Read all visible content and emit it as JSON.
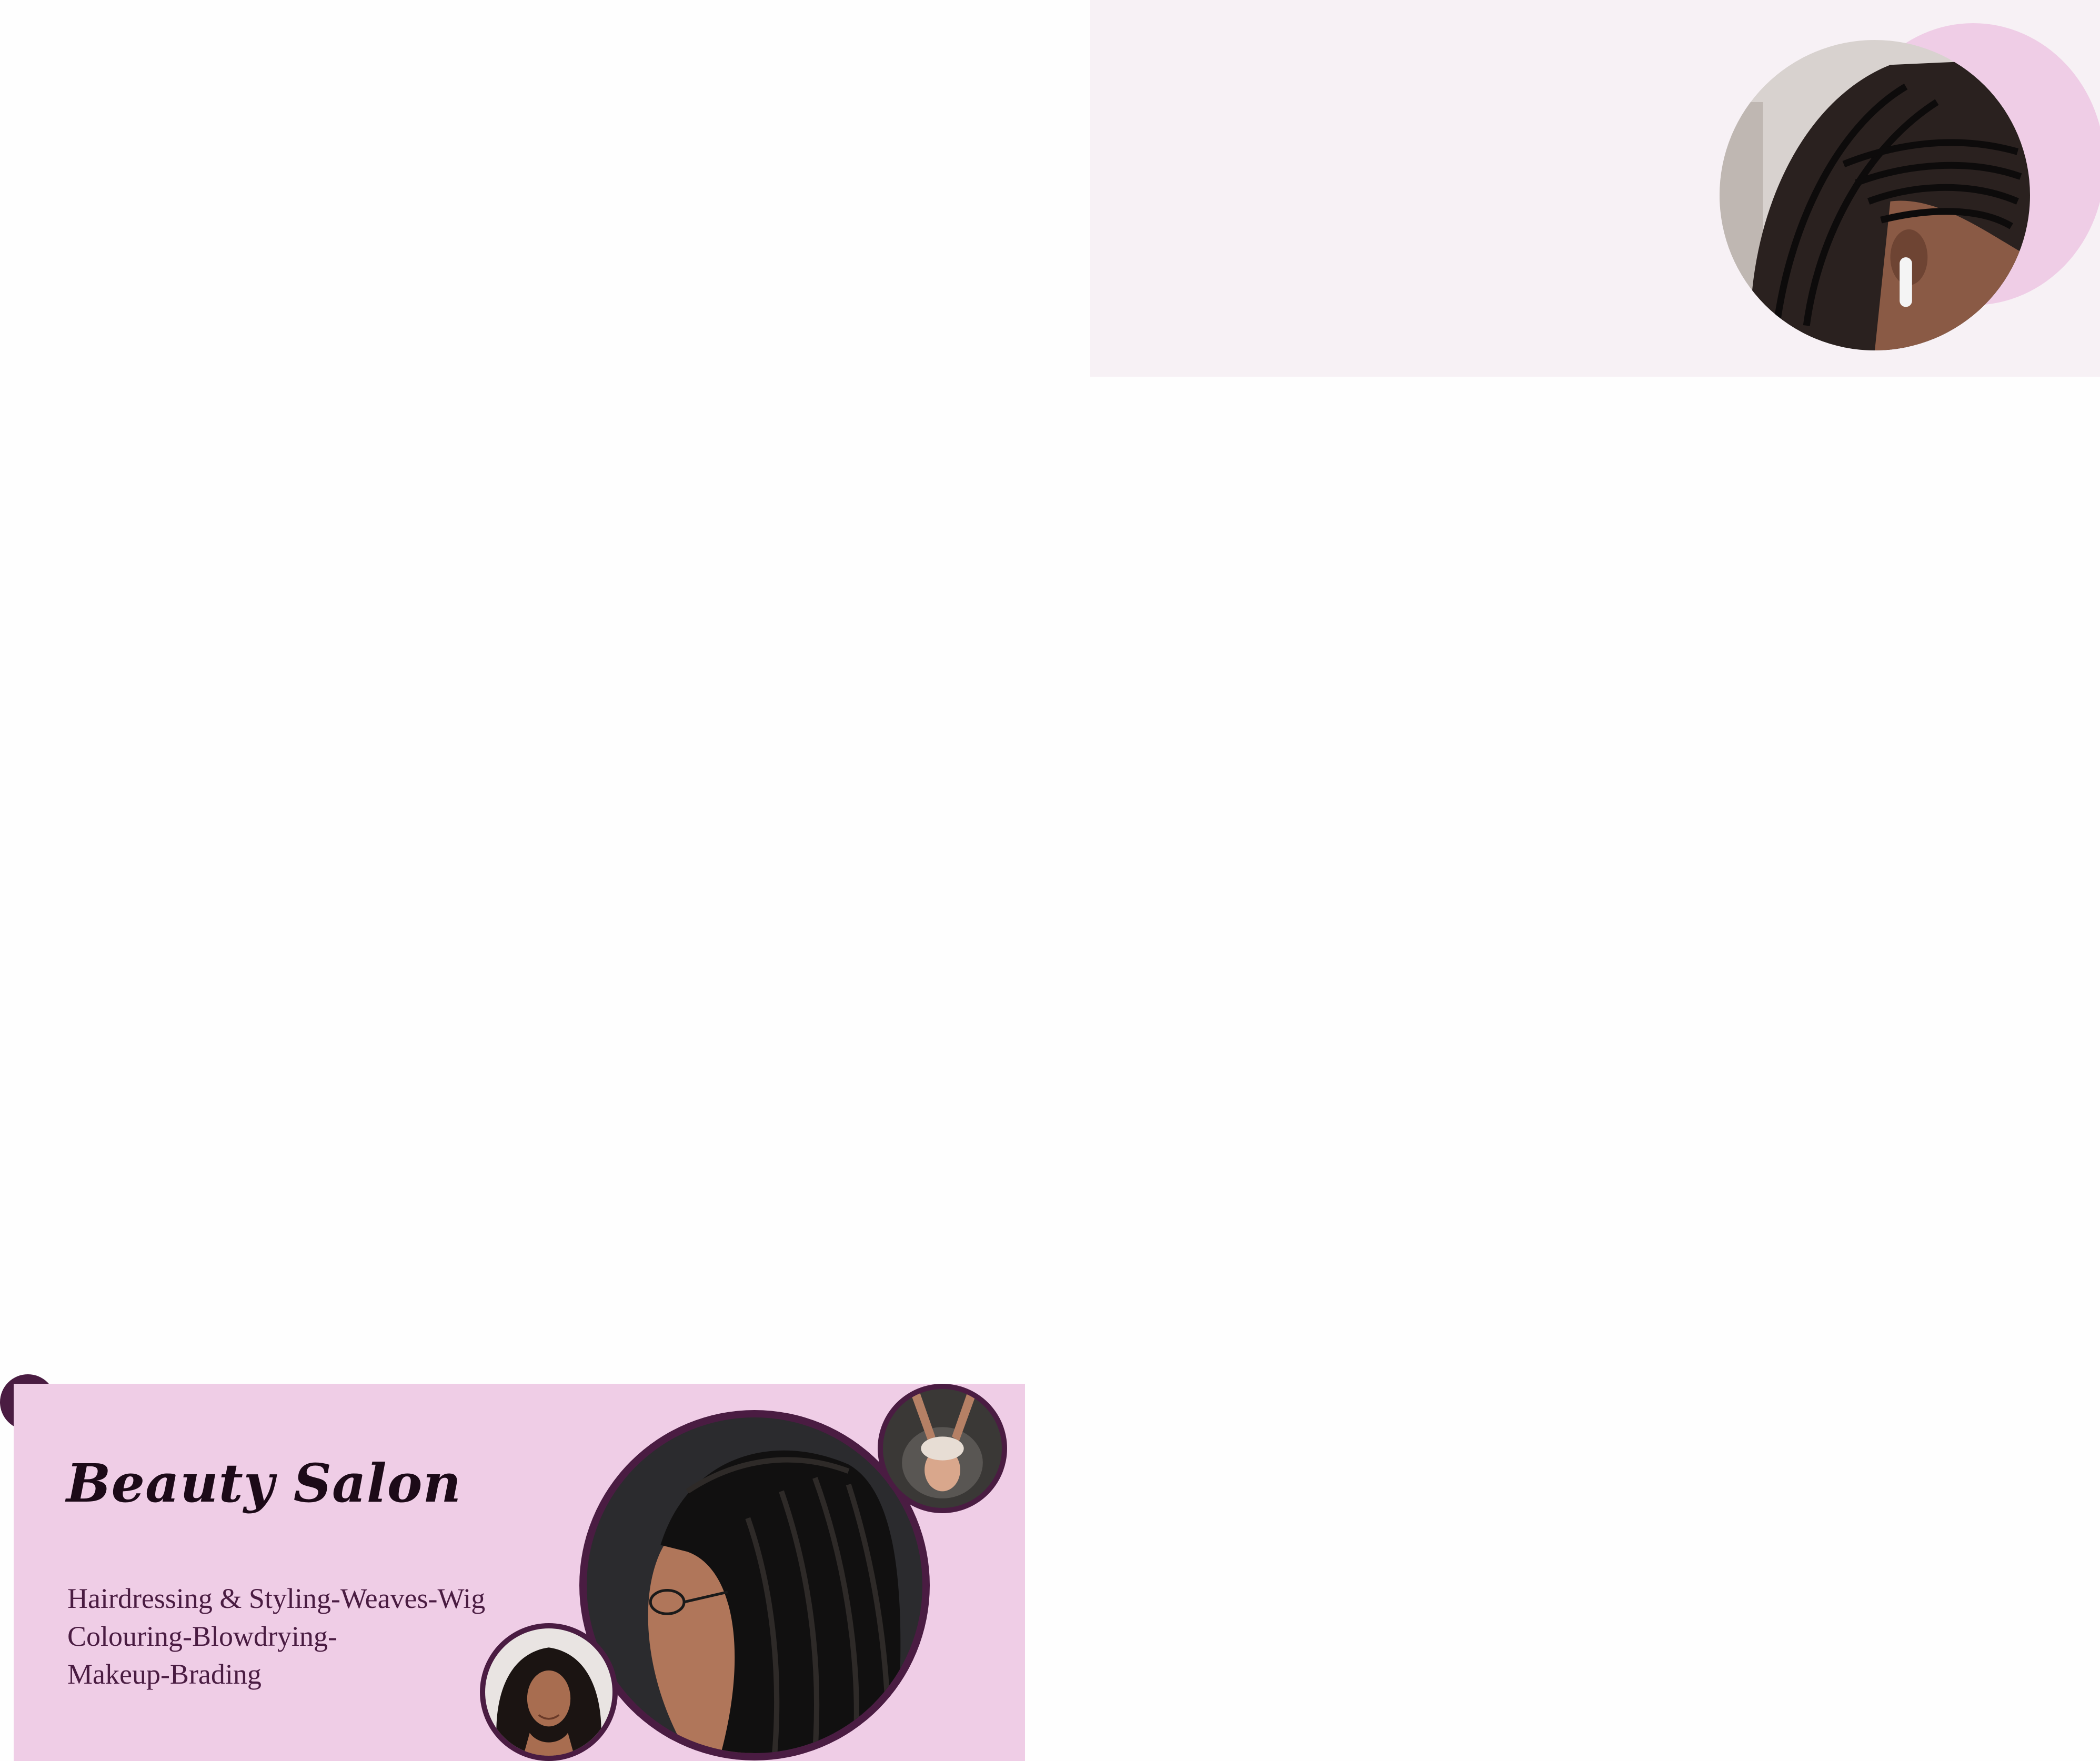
{
  "banner": {
    "title": "Beauty Salon",
    "services": [
      "Hairdressing & Styling-Weaves-Wig",
      "Colouring-Blowdrying-",
      "Makeup-Brading"
    ]
  },
  "colors": {
    "plum": "#4a1c42",
    "pink": "#efcde6",
    "light_panel": "#f7f1f5"
  },
  "images": {
    "top_photo": "cornrow-braids-photo",
    "big_photo": "box-braids-profile-photo",
    "small_top_photo": "hair-wash-photo",
    "small_bottom_photo": "curly-hair-photo"
  }
}
